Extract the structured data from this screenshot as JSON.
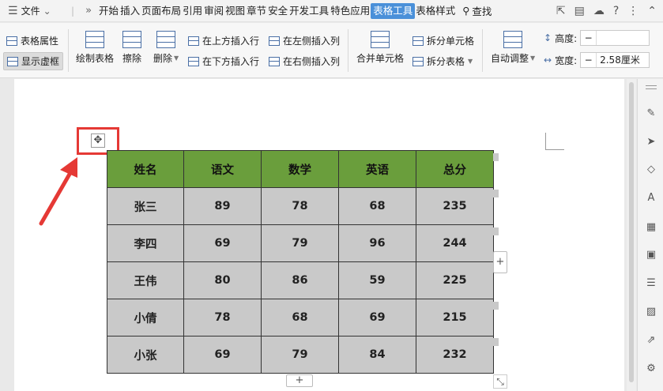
{
  "menubar": {
    "file_label": "文件",
    "more": "»",
    "tabs": [
      "开始",
      "插入",
      "页面布局",
      "引用",
      "审阅",
      "视图",
      "章节",
      "安全",
      "开发工具",
      "特色应用",
      "表格工具",
      "表格样式"
    ],
    "active_tab": "表格工具",
    "search_label": "查找"
  },
  "ribbon": {
    "table_props": "表格属性",
    "show_gridlines": "显示虚框",
    "draw_table": "绘制表格",
    "erase": "擦除",
    "delete": "删除",
    "insert_above": "在上方插入行",
    "insert_below": "在下方插入行",
    "insert_left": "在左侧插入列",
    "insert_right": "在右侧插入列",
    "merge_cells": "合并单元格",
    "split_cells": "拆分单元格",
    "split_table": "拆分表格",
    "auto_fit": "自动调整",
    "height_label": "高度:",
    "height_minus": "−",
    "height_value": "",
    "width_label": "宽度:",
    "width_minus": "−",
    "width_value": "2.58厘米"
  },
  "table": {
    "headers": [
      "姓名",
      "语文",
      "数学",
      "英语",
      "总分"
    ],
    "rows": [
      [
        "张三",
        "89",
        "78",
        "68",
        "235"
      ],
      [
        "李四",
        "69",
        "79",
        "96",
        "244"
      ],
      [
        "王伟",
        "80",
        "86",
        "59",
        "225"
      ],
      [
        "小倩",
        "78",
        "68",
        "69",
        "215"
      ],
      [
        "小张",
        "69",
        "79",
        "84",
        "232"
      ]
    ]
  },
  "controls": {
    "mover_glyph": "✥",
    "add_col": "+",
    "add_row": "+",
    "resize_glyph": "⤡"
  },
  "colors": {
    "header_bg": "#6a9e3c",
    "cell_bg": "#c9c9c9",
    "highlight": "#e53935",
    "active_tab": "#4a90d9"
  }
}
